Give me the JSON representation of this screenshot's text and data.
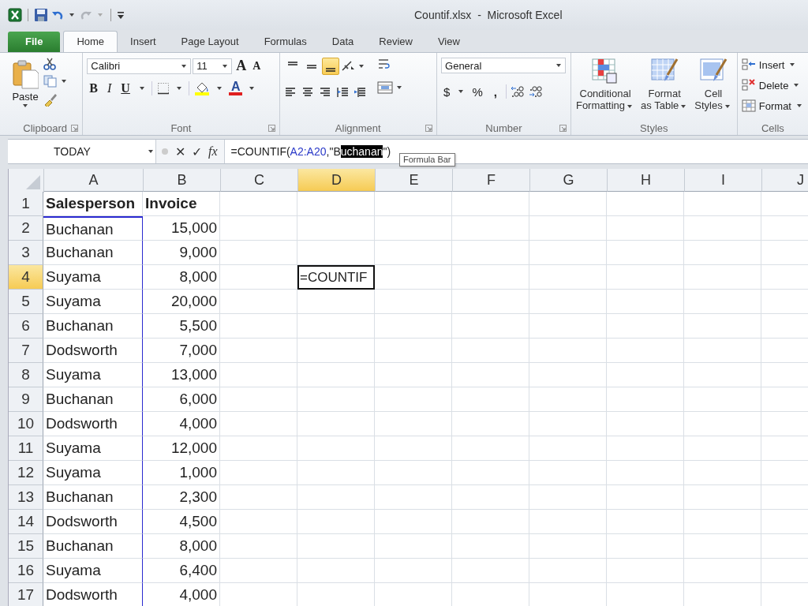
{
  "window": {
    "title": "Countif.xlsx  -  Microsoft Excel"
  },
  "quick_access": {
    "undo_enabled": true,
    "redo_enabled": false
  },
  "tabs": [
    {
      "label": "File",
      "kind": "file",
      "selected": false
    },
    {
      "label": "Home",
      "kind": "tab",
      "selected": true
    },
    {
      "label": "Insert",
      "kind": "tab",
      "selected": false
    },
    {
      "label": "Page Layout",
      "kind": "tab",
      "selected": false
    },
    {
      "label": "Formulas",
      "kind": "tab",
      "selected": false
    },
    {
      "label": "Data",
      "kind": "tab",
      "selected": false
    },
    {
      "label": "Review",
      "kind": "tab",
      "selected": false
    },
    {
      "label": "View",
      "kind": "tab",
      "selected": false
    }
  ],
  "ribbon": {
    "clipboard": {
      "label": "Clipboard",
      "paste": "Paste"
    },
    "font": {
      "label": "Font",
      "font_name": "Calibri",
      "font_size": "11",
      "grow_font": "A",
      "shrink_font": "A",
      "bold": "B",
      "italic": "I",
      "underline": "U",
      "font_color": "A"
    },
    "alignment": {
      "label": "Alignment",
      "vertical": [
        {
          "selected": false
        },
        {
          "selected": false
        },
        {
          "selected": true
        }
      ]
    },
    "number": {
      "label": "Number",
      "format": "General",
      "currency": "$",
      "percent": "%",
      "comma": ","
    },
    "styles": {
      "label": "Styles",
      "buttons": [
        {
          "lines": [
            "Conditional",
            "Formatting"
          ]
        },
        {
          "lines": [
            "Format",
            "as Table"
          ]
        },
        {
          "lines": [
            "Cell",
            "Styles"
          ]
        }
      ]
    },
    "cells": {
      "label": "Cells",
      "buttons": [
        "Insert",
        "Delete",
        "Format"
      ]
    }
  },
  "formula_bar": {
    "name_box": "TODAY",
    "cancel": "✕",
    "enter": "✓",
    "function_label": "fx",
    "formula": [
      {
        "text": "=COUNTIF(",
        "kind": "plain"
      },
      {
        "text": "A2:A20",
        "kind": "reference"
      },
      {
        "text": ",\"B",
        "kind": "plain"
      },
      {
        "text": "uchanan",
        "kind": "selected"
      },
      {
        "text": "\")",
        "kind": "plain"
      }
    ],
    "tooltip": "Formula Bar"
  },
  "sheet": {
    "columns": [
      {
        "label": "A",
        "selected": false
      },
      {
        "label": "B",
        "selected": false
      },
      {
        "label": "C",
        "selected": false
      },
      {
        "label": "D",
        "selected": true
      },
      {
        "label": "E",
        "selected": false
      },
      {
        "label": "F",
        "selected": false
      },
      {
        "label": "G",
        "selected": false
      },
      {
        "label": "H",
        "selected": false
      },
      {
        "label": "I",
        "selected": false
      },
      {
        "label": "J",
        "selected": false
      }
    ],
    "rows": [
      {
        "number": "1",
        "selected": false,
        "referenced": false,
        "kind": "heading",
        "cells": {
          "A": "Salesperson",
          "B": "Invoice"
        }
      },
      {
        "number": "2",
        "selected": false,
        "referenced": true,
        "kind": "data",
        "cells": {
          "A": "Buchanan",
          "B": "15,000"
        }
      },
      {
        "number": "3",
        "selected": false,
        "referenced": true,
        "kind": "data",
        "cells": {
          "A": "Buchanan",
          "B": "9,000"
        }
      },
      {
        "number": "4",
        "selected": true,
        "referenced": true,
        "kind": "data",
        "cells": {
          "A": "Suyama",
          "B": "8,000",
          "D": "=COUNTIF"
        }
      },
      {
        "number": "5",
        "selected": false,
        "referenced": true,
        "kind": "data",
        "cells": {
          "A": "Suyama",
          "B": "20,000"
        }
      },
      {
        "number": "6",
        "selected": false,
        "referenced": true,
        "kind": "data",
        "cells": {
          "A": "Buchanan",
          "B": "5,500"
        }
      },
      {
        "number": "7",
        "selected": false,
        "referenced": true,
        "kind": "data",
        "cells": {
          "A": "Dodsworth",
          "B": "7,000"
        }
      },
      {
        "number": "8",
        "selected": false,
        "referenced": true,
        "kind": "data",
        "cells": {
          "A": "Suyama",
          "B": "13,000"
        }
      },
      {
        "number": "9",
        "selected": false,
        "referenced": true,
        "kind": "data",
        "cells": {
          "A": "Buchanan",
          "B": "6,000"
        }
      },
      {
        "number": "10",
        "selected": false,
        "referenced": true,
        "kind": "data",
        "cells": {
          "A": "Dodsworth",
          "B": "4,000"
        }
      },
      {
        "number": "11",
        "selected": false,
        "referenced": true,
        "kind": "data",
        "cells": {
          "A": "Suyama",
          "B": "12,000"
        }
      },
      {
        "number": "12",
        "selected": false,
        "referenced": true,
        "kind": "data",
        "cells": {
          "A": "Suyama",
          "B": "1,000"
        }
      },
      {
        "number": "13",
        "selected": false,
        "referenced": true,
        "kind": "data",
        "cells": {
          "A": "Buchanan",
          "B": "2,300"
        }
      },
      {
        "number": "14",
        "selected": false,
        "referenced": true,
        "kind": "data",
        "cells": {
          "A": "Dodsworth",
          "B": "4,500"
        }
      },
      {
        "number": "15",
        "selected": false,
        "referenced": true,
        "kind": "data",
        "cells": {
          "A": "Buchanan",
          "B": "8,000"
        }
      },
      {
        "number": "16",
        "selected": false,
        "referenced": true,
        "kind": "data",
        "cells": {
          "A": "Suyama",
          "B": "6,400"
        }
      },
      {
        "number": "17",
        "selected": false,
        "referenced": true,
        "kind": "data",
        "cells": {
          "A": "Dodsworth",
          "B": "4,000"
        }
      }
    ]
  }
}
